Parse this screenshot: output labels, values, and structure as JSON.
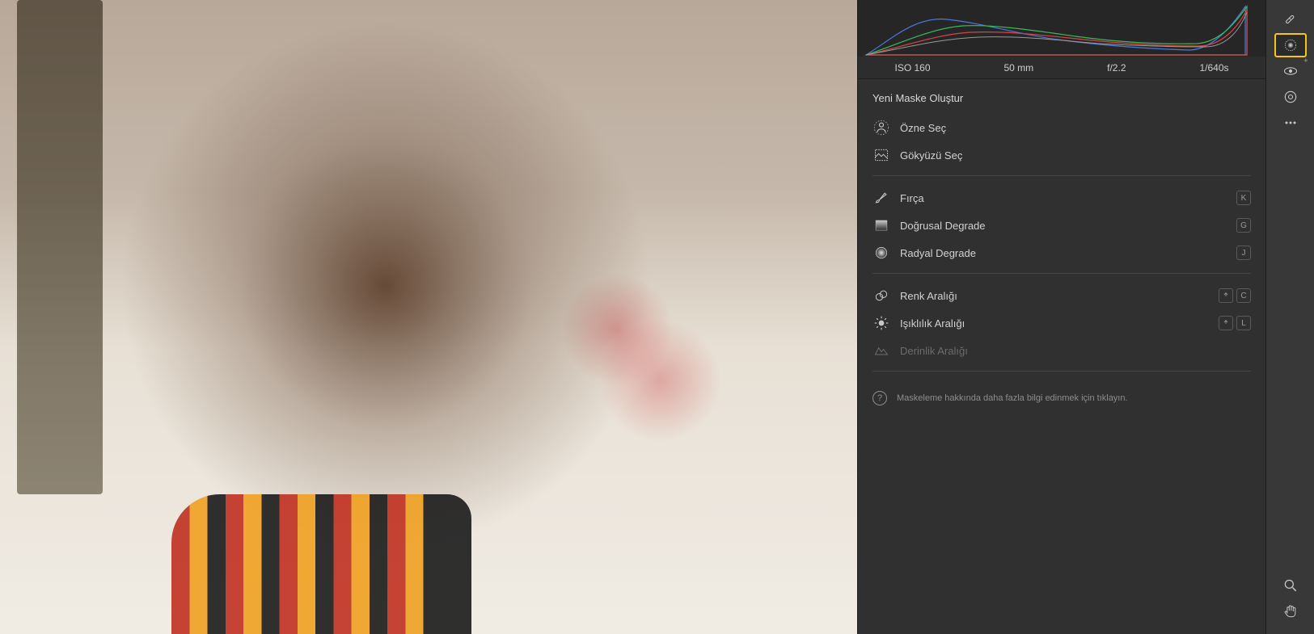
{
  "exif": {
    "iso": "ISO 160",
    "focal": "50 mm",
    "aperture": "f/2.2",
    "shutter": "1/640s"
  },
  "panel": {
    "title": "Yeni Maske Oluştur",
    "ai_tools": [
      {
        "label": "Özne Seç",
        "icon": "subject"
      },
      {
        "label": "Gökyüzü Seç",
        "icon": "sky"
      }
    ],
    "masks": [
      {
        "label": "Fırça",
        "icon": "brush",
        "keys": [
          "K"
        ]
      },
      {
        "label": "Doğrusal Degrade",
        "icon": "linear",
        "keys": [
          "G"
        ]
      },
      {
        "label": "Radyal Degrade",
        "icon": "radial",
        "keys": [
          "J"
        ]
      }
    ],
    "ranges": [
      {
        "label": "Renk Aralığı",
        "icon": "color",
        "keys": [
          "shift",
          "C"
        ],
        "disabled": false
      },
      {
        "label": "Işıklılık Aralığı",
        "icon": "luminance",
        "keys": [
          "shift",
          "L"
        ],
        "disabled": false
      },
      {
        "label": "Derinlik Aralığı",
        "icon": "depth",
        "keys": [],
        "disabled": true
      }
    ],
    "help": "Maskeleme hakkında daha fazla bilgi edinmek için tıklayın."
  },
  "rail": {
    "tools": [
      {
        "name": "healing",
        "selected": false,
        "plus": false
      },
      {
        "name": "masking",
        "selected": true,
        "plus": false
      },
      {
        "name": "redeye",
        "selected": false,
        "plus": true
      },
      {
        "name": "presets",
        "selected": false,
        "plus": false
      },
      {
        "name": "more",
        "selected": false,
        "plus": false
      }
    ],
    "bottom": [
      {
        "name": "zoom"
      },
      {
        "name": "hand"
      }
    ]
  }
}
